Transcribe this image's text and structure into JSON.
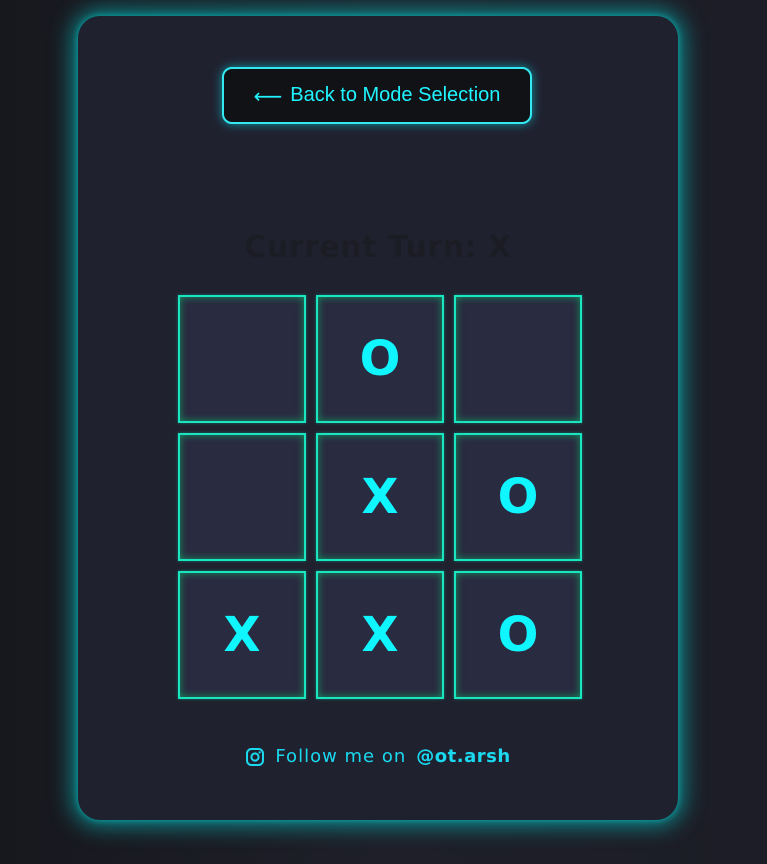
{
  "back_button": {
    "arrow": "⟵",
    "label": "Back to Mode Selection"
  },
  "status": {
    "turn_text": "Current Turn: X"
  },
  "board": {
    "cells": [
      {
        "mark": ""
      },
      {
        "mark": "O"
      },
      {
        "mark": ""
      },
      {
        "mark": ""
      },
      {
        "mark": "X"
      },
      {
        "mark": "O"
      },
      {
        "mark": "X"
      },
      {
        "mark": "X"
      },
      {
        "mark": "O"
      }
    ]
  },
  "footer": {
    "icon": "instagram-icon",
    "label": "Follow me on",
    "handle": "@ot.arsh"
  },
  "colors": {
    "accent": "#1ff4ff",
    "cell_border": "#19e6c0",
    "card_bg": "#20212f"
  }
}
